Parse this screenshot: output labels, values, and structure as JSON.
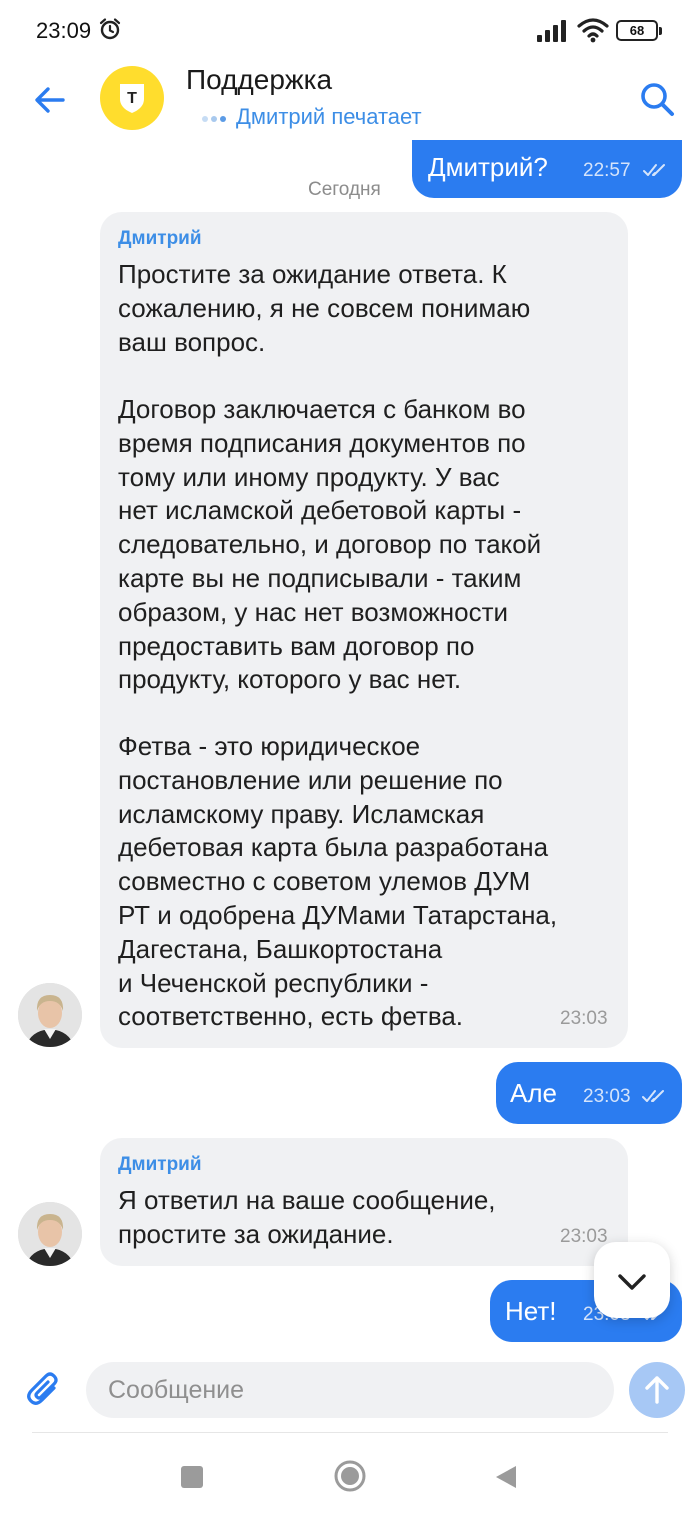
{
  "status_bar": {
    "time": "23:09",
    "battery": "68"
  },
  "header": {
    "title": "Поддержка",
    "typing_status": "Дмитрий печатает",
    "brand_color": "#ffdd2d",
    "logo_letter": "Т"
  },
  "chat": {
    "date_separator": "Сегодня",
    "messages": [
      {
        "from": "me",
        "text": "Дмитрий?",
        "time": "22:57",
        "read": true
      },
      {
        "from": "agent",
        "sender": "Дмитрий",
        "paragraphs": [
          [
            "Простите за ожидание ответа. К",
            "сожалению, я не совсем понимаю",
            "ваш вопрос."
          ],
          [
            "Договор заключается с банком во",
            "время подписания документов по",
            "тому или иному продукту. У вас",
            "нет исламской дебетовой карты -",
            "следовательно, и договор по такой",
            "карте вы не подписывали - таким",
            "образом, у нас нет возможности",
            "предоставить вам договор по",
            "продукту, которого у вас нет."
          ],
          [
            "Фетва - это юридическое",
            "постановление или решение по",
            "исламскому праву. Исламская",
            "дебетовая карта была разработана",
            "совместно с советом улемов ДУМ",
            "РТ и одобрена ДУМами Татарстана,",
            "Дагестана, Башкортостана",
            "и Чеченской республики -",
            "соответственно, есть фетва."
          ]
        ],
        "time": "23:03"
      },
      {
        "from": "me",
        "text": "Але",
        "time": "23:03",
        "read": true
      },
      {
        "from": "agent",
        "sender": "Дмитрий",
        "paragraphs": [
          [
            "Я ответил на ваше сообщение,",
            "простите за ожидание."
          ]
        ],
        "time": "23:03"
      },
      {
        "from": "me",
        "text": "Нет!",
        "time": "23:03",
        "read": true
      }
    ]
  },
  "composer": {
    "placeholder": "Сообщение"
  },
  "colors": {
    "accent": "#2b7cf0",
    "link": "#3d8ee6",
    "bubble_in": "#f0f1f3",
    "send_disabled": "#a7c8f5"
  }
}
